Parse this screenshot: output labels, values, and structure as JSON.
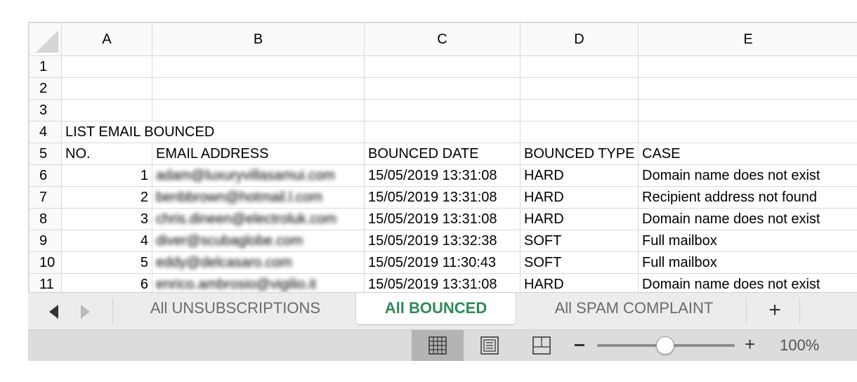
{
  "columns": [
    "A",
    "B",
    "C",
    "D",
    "E"
  ],
  "rows": [
    {
      "n": "1",
      "a": "",
      "b": "",
      "c": "",
      "d": "",
      "e": ""
    },
    {
      "n": "2",
      "a": "",
      "b": "",
      "c": "",
      "d": "",
      "e": ""
    },
    {
      "n": "3",
      "a": "",
      "b": "",
      "c": "",
      "d": "",
      "e": ""
    },
    {
      "n": "4",
      "a": "LIST EMAIL BOUNCED",
      "b": "",
      "c": "",
      "d": "",
      "e": ""
    },
    {
      "n": "5",
      "a": "NO.",
      "b": "EMAIL ADDRESS",
      "c": "BOUNCED DATE",
      "d": "BOUNCED TYPE",
      "e": "CASE"
    },
    {
      "n": "6",
      "a": "1",
      "b": "adam@luxuryvillasamui.com",
      "c": "15/05/2019 13:31:08",
      "d": "HARD",
      "e": "Domain name does not exist"
    },
    {
      "n": "7",
      "a": "2",
      "b": "benbbrown@hotmail.l.com",
      "c": "15/05/2019 13:31:08",
      "d": "HARD",
      "e": "Recipient address not found"
    },
    {
      "n": "8",
      "a": "3",
      "b": "chris.dineen@electroluk.com",
      "c": "15/05/2019 13:31:08",
      "d": "HARD",
      "e": "Domain name does not exist"
    },
    {
      "n": "9",
      "a": "4",
      "b": "diver@scubaglobe.com",
      "c": "15/05/2019 13:32:38",
      "d": "SOFT",
      "e": "Full mailbox"
    },
    {
      "n": "10",
      "a": "5",
      "b": "eddy@delcasaro.com",
      "c": "15/05/2019 11:30:43",
      "d": "SOFT",
      "e": "Full mailbox"
    },
    {
      "n": "11",
      "a": "6",
      "b": "enrico.ambrosio@vigilio.it",
      "c": "15/05/2019 13:31:08",
      "d": "HARD",
      "e": "Domain name does not exist"
    }
  ],
  "tabs": [
    {
      "label": "All UNSUBSCRIPTIONS",
      "active": false
    },
    {
      "label": "All BOUNCED",
      "active": true
    },
    {
      "label": "All SPAM COMPLAINT",
      "active": false
    }
  ],
  "add_sheet_label": "+",
  "zoom": {
    "value": "100%",
    "minus": "–",
    "plus": "+"
  },
  "colors": {
    "active_tab": "#2e8b57",
    "status_bar": "#dcdcdc"
  }
}
